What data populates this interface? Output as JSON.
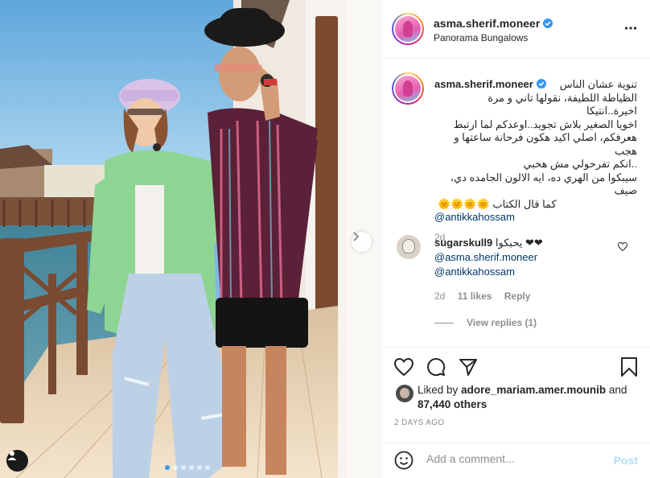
{
  "post": {
    "username": "asma.sherif.moneer",
    "location": "Panorama Bungalows",
    "caption_lines": [
      "تنوية عشان الناس",
      "الظياطة اللطيفة، نقولها تاني و مرة اخيرة..انتيكا",
      "اخويا الصغير بلاش تجويد..اوعدكم لما ارتبط",
      "هعرفكم، اصلي اكيد هكون فرحانة ساعتها و هجب",
      "..انكم تفرحولي مش هخبي",
      "سيبكوا من الهري ده، ايه الالون الجامده دي، صيف",
      "كما قال الكتاب 🌞🌞🌞🌞"
    ],
    "caption_mention": "@antikkahossam",
    "caption_time": "2d"
  },
  "comment": {
    "username": "sugarskull9",
    "text": "يحبكوا ❤❤",
    "mentions": [
      "@asma.sherif.moneer",
      "@antikkahossam"
    ],
    "time": "2d",
    "likes": "11 likes",
    "reply_label": "Reply",
    "view_replies": "View replies (1)"
  },
  "likes": {
    "prefix": "Liked by",
    "user": "adore_mariam.amer.mounib",
    "joiner": "and",
    "others": "87,440 others"
  },
  "date": "2 DAYS AGO",
  "add_comment": {
    "placeholder": "Add a comment...",
    "post_label": "Post"
  },
  "carousel": {
    "count": 6,
    "active_index": 0
  },
  "colors": {
    "accent": "#3897f0",
    "link": "#00376b",
    "muted": "#8e8e8e",
    "post_disabled": "#b2dffc",
    "border": "#efefef"
  },
  "icons": [
    "more-options-icon",
    "verified-badge-icon",
    "heart-icon",
    "comment-icon",
    "share-icon",
    "bookmark-icon",
    "emoji-icon",
    "next-arrow-icon",
    "user-tag-icon"
  ]
}
